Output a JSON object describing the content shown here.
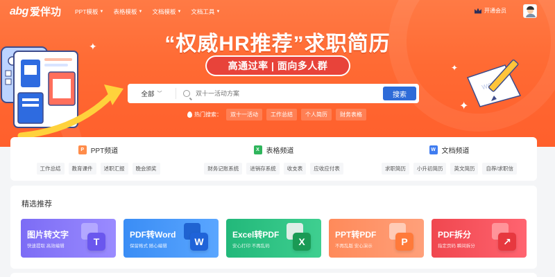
{
  "brand": {
    "logo_latin": "abg",
    "logo_cn": "爱伴功"
  },
  "nav": [
    {
      "label": "PPT模板"
    },
    {
      "label": "表格模板"
    },
    {
      "label": "文档模板"
    },
    {
      "label": "文档工具"
    }
  ],
  "header": {
    "vip_label": "开通会员"
  },
  "hero": {
    "headline": "“权威HR推荐”求职简历",
    "subtitle": "高通过率 | 面向多人群",
    "search": {
      "scope": "全部",
      "placeholder": "双十一活动方案",
      "button": "搜索"
    },
    "hot_label": "热门搜索：",
    "hot_tags": [
      "双十一活动",
      "工作总结",
      "个人简历",
      "财务表格"
    ],
    "doc_word_text": "WORD"
  },
  "channels": [
    {
      "title": "PPT频道",
      "badge": "P",
      "color": "#ff8c4a",
      "tags": [
        "工作总结",
        "教育课件",
        "述职汇报",
        "晚会颁奖"
      ]
    },
    {
      "title": "表格频道",
      "badge": "X",
      "color": "#2fb55c",
      "tags": [
        "财务记账系统",
        "进销存系统",
        "收支表",
        "应收应付表"
      ]
    },
    {
      "title": "文档频道",
      "badge": "W",
      "color": "#3f7cf0",
      "tags": [
        "求职简历",
        "小升初简历",
        "英文简历",
        "自荐/求职信"
      ]
    }
  ],
  "recommend": {
    "title": "精选推荐",
    "cards": [
      {
        "title": "图片转文字",
        "subtitle": "快速提取 高效编辑",
        "letter": "T",
        "colors": {
          "bg_from": "#7c6cf5",
          "bg_to": "#9a8bff",
          "icon": "#6a57ee",
          "icon_back": "#b7acff"
        }
      },
      {
        "title": "PDF转Word",
        "subtitle": "保留格式 随心编辑",
        "letter": "W",
        "colors": {
          "bg_from": "#3a8df5",
          "bg_to": "#5aa6ff",
          "icon": "#1f63d8",
          "icon_back": "#1a5ccc"
        }
      },
      {
        "title": "Excel转PDF",
        "subtitle": "安心打印 不再乱码",
        "letter": "X",
        "colors": {
          "bg_from": "#22b87a",
          "bg_to": "#3fcf90",
          "icon": "#1a9a55",
          "icon_back": "#f2f2f2"
        }
      },
      {
        "title": "PPT转PDF",
        "subtitle": "不再乱版 安心演示",
        "letter": "P",
        "colors": {
          "bg_from": "#ff8a5a",
          "bg_to": "#ffa07a",
          "icon": "#ff7a3a",
          "icon_back": "#ffd2bf"
        }
      },
      {
        "title": "PDF拆分",
        "subtitle": "指定页码 瞬间拆分",
        "letter": "↗",
        "colors": {
          "bg_from": "#f0474f",
          "bg_to": "#ff6470",
          "icon": "#e7383f",
          "icon_back": "#ff9aa0"
        }
      }
    ]
  }
}
